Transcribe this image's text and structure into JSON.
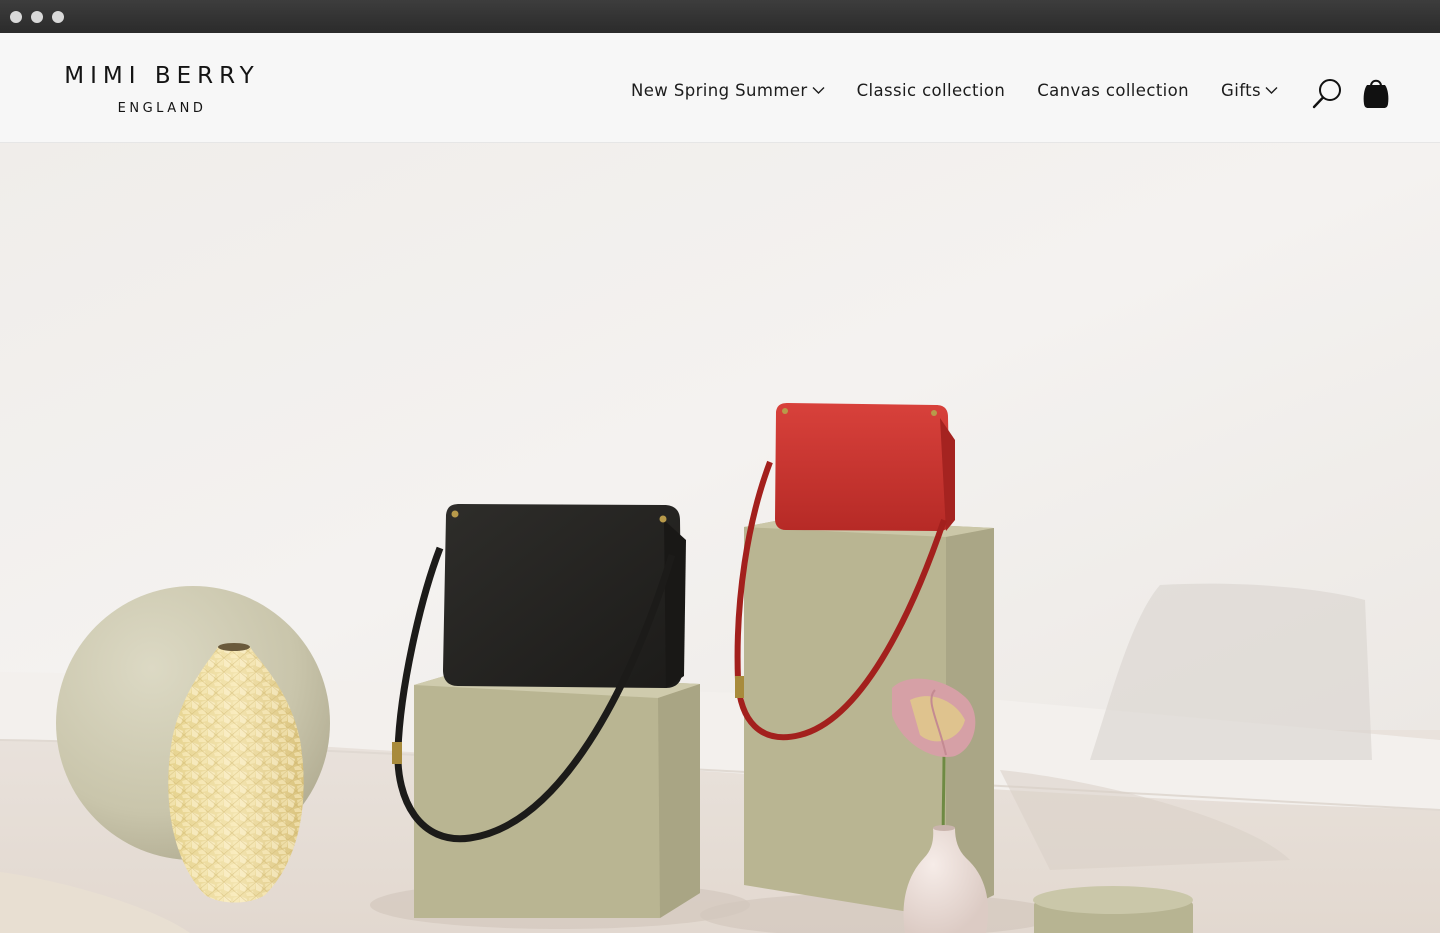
{
  "brand": {
    "name": "MIMI BERRY",
    "sub": "ENGLAND"
  },
  "nav": {
    "items": [
      {
        "label": "New Spring Summer",
        "has_dropdown": true
      },
      {
        "label": "Classic collection",
        "has_dropdown": false
      },
      {
        "label": "Canvas collection",
        "has_dropdown": false
      },
      {
        "label": "Gifts",
        "has_dropdown": true
      }
    ]
  },
  "icons": {
    "search": "search-icon",
    "bag": "shopping-bag-icon",
    "dropdown": "chevron-down-icon"
  },
  "colors": {
    "header_bg": "#f7f7f7",
    "text": "#1c1c1c",
    "plinth": "#b9b592",
    "red_bag": "#c9302c",
    "black_bag": "#242321"
  }
}
